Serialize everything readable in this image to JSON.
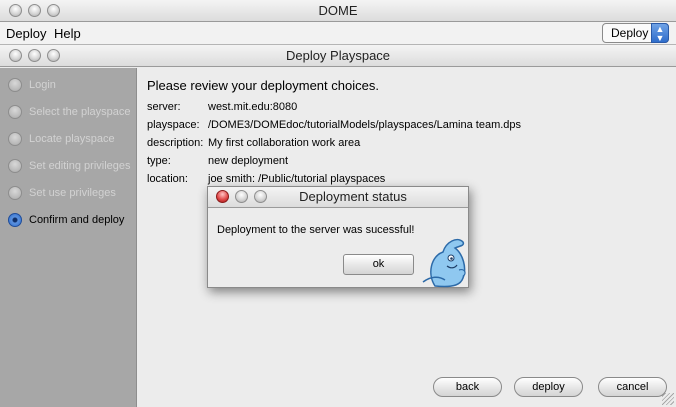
{
  "app": {
    "title": "DOME",
    "menu": [
      "Deploy",
      "Help"
    ],
    "mode_select": "Deploy"
  },
  "wizard": {
    "title": "Deploy Playspace",
    "steps": [
      {
        "label": "Login",
        "active": false
      },
      {
        "label": "Select the playspace",
        "active": false
      },
      {
        "label": "Locate playspace",
        "active": false
      },
      {
        "label": "Set editing privileges",
        "active": false
      },
      {
        "label": "Set use privileges",
        "active": false
      },
      {
        "label": "Confirm and deploy",
        "active": true
      }
    ],
    "heading": "Please review your deployment choices.",
    "details": [
      {
        "key": "server:",
        "value": "west.mit.edu:8080"
      },
      {
        "key": "playspace:",
        "value": "/DOME3/DOMEdoc/tutorialModels/playspaces/Lamina team.dps"
      },
      {
        "key": "description:",
        "value": "My first collaboration work area"
      },
      {
        "key": "type:",
        "value": "new deployment"
      },
      {
        "key": "location:",
        "value": "joe smith: /Public/tutorial playspaces"
      }
    ],
    "buttons": {
      "back": "back",
      "deploy": "deploy",
      "cancel": "cancel"
    }
  },
  "dialog": {
    "title": "Deployment status",
    "message": "Deployment to the server was sucessful!",
    "ok": "ok"
  },
  "colors": {
    "sidebar": "#a7a7a7",
    "accent": "#2f6dcb",
    "close_red": "#e14b4b"
  }
}
